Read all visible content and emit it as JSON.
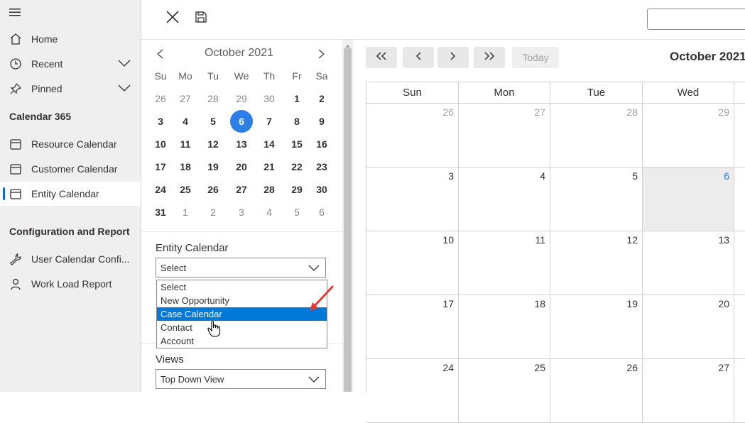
{
  "sidebar": {
    "nav": [
      {
        "label": "Home",
        "icon": "home-icon"
      },
      {
        "label": "Recent",
        "icon": "clock-icon"
      },
      {
        "label": "Pinned",
        "icon": "pin-icon"
      }
    ],
    "section1_title": "Calendar 365",
    "section1_items": [
      {
        "label": "Resource Calendar",
        "icon": "calendar-icon"
      },
      {
        "label": "Customer Calendar",
        "icon": "calendar-icon"
      },
      {
        "label": "Entity Calendar",
        "icon": "calendar-icon",
        "active": true
      }
    ],
    "section2_title": "Configuration and Report",
    "section2_items": [
      {
        "label": "User Calendar Confi...",
        "icon": "wrench-icon"
      },
      {
        "label": "Work Load Report",
        "icon": "person-icon"
      }
    ]
  },
  "mini_calendar": {
    "month_label": "October 2021",
    "weekdays": [
      "Su",
      "Mo",
      "Tu",
      "We",
      "Th",
      "Fr",
      "Sa"
    ],
    "weeks": [
      [
        "26",
        "27",
        "28",
        "29",
        "30",
        "1",
        "2"
      ],
      [
        "3",
        "4",
        "5",
        "6",
        "7",
        "8",
        "9"
      ],
      [
        "10",
        "11",
        "12",
        "13",
        "14",
        "15",
        "16"
      ],
      [
        "17",
        "18",
        "19",
        "20",
        "21",
        "22",
        "23"
      ],
      [
        "24",
        "25",
        "26",
        "27",
        "28",
        "29",
        "30"
      ],
      [
        "31",
        "1",
        "2",
        "3",
        "4",
        "5",
        "6"
      ]
    ],
    "selected_day": "6"
  },
  "entity_calendar": {
    "label": "Entity Calendar",
    "value": "Select",
    "options": [
      "Select",
      "New Opportunity",
      "Case Calendar",
      "Contact",
      "Account"
    ],
    "highlighted": "Case Calendar"
  },
  "views": {
    "label": "Views",
    "value": "Top Down View"
  },
  "main_calendar": {
    "today_label": "Today",
    "month_title": "October 2021",
    "day_headers": [
      "Sun",
      "Mon",
      "Tue",
      "Wed"
    ],
    "weeks": [
      [
        "26",
        "27",
        "28",
        "29"
      ],
      [
        "3",
        "4",
        "5",
        "6"
      ],
      [
        "10",
        "11",
        "12",
        "13"
      ],
      [
        "17",
        "18",
        "19",
        "20"
      ],
      [
        "24",
        "25",
        "26",
        "27"
      ]
    ],
    "today_cell": "6"
  },
  "colors": {
    "accent": "#0f6cbd",
    "today_blue": "#2e7ee8",
    "highlight": "#0078d7",
    "arrow": "#e53935"
  }
}
